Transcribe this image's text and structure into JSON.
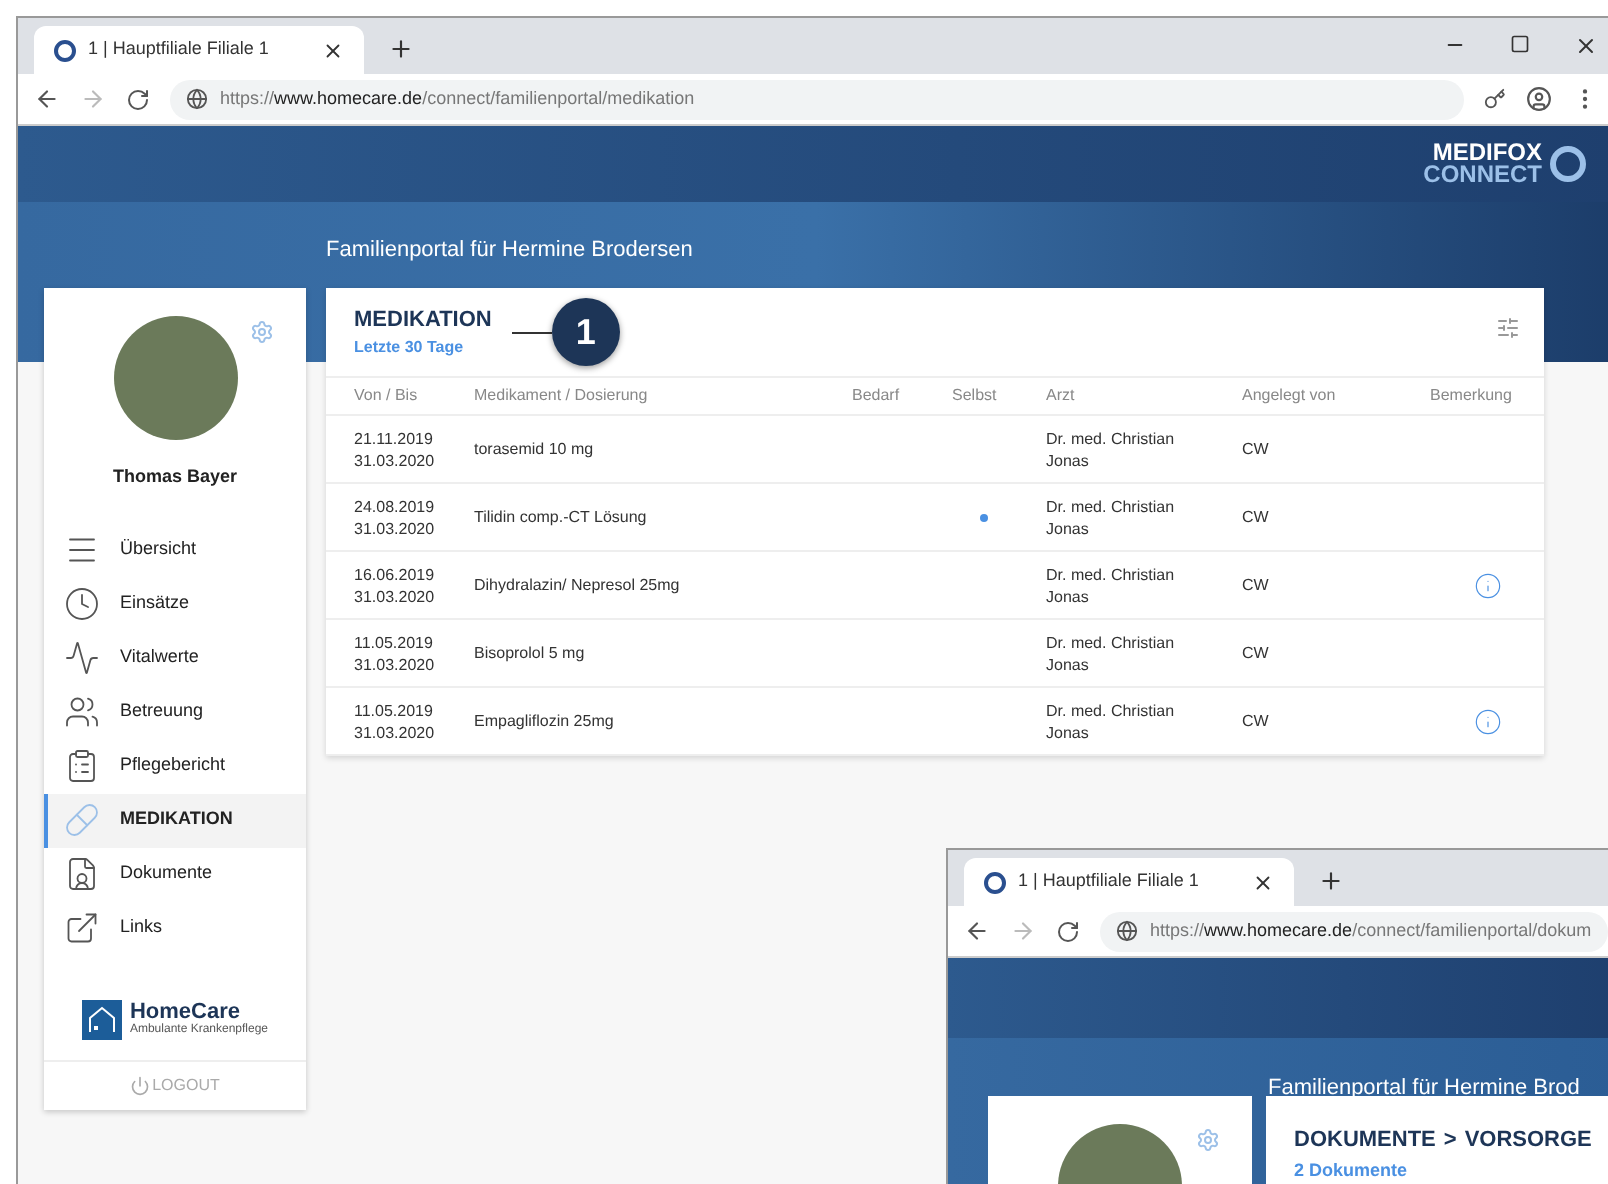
{
  "browser": {
    "tab_title": "1 | Hauptfiliale Filiale 1",
    "url_scheme": "https://",
    "url_host": "www.homecare.de",
    "url_path": "/connect/familienportal/medikation"
  },
  "brand": {
    "line1": "MEDIFOX",
    "line2": "CONNECT"
  },
  "portal_title": "Familienportal für Hermine Brodersen",
  "sidebar": {
    "user_name": "Thomas Bayer",
    "items": [
      {
        "kind": "overview",
        "label": "Übersicht",
        "selected": false
      },
      {
        "kind": "visits",
        "label": "Einsätze",
        "selected": false
      },
      {
        "kind": "vitals",
        "label": "Vitalwerte",
        "selected": false
      },
      {
        "kind": "care",
        "label": "Betreuung",
        "selected": false
      },
      {
        "kind": "report",
        "label": "Pflegebericht",
        "selected": false
      },
      {
        "kind": "medication",
        "label": "MEDIKATION",
        "selected": true
      },
      {
        "kind": "documents",
        "label": "Dokumente",
        "selected": false
      },
      {
        "kind": "links",
        "label": "Links",
        "selected": false
      }
    ],
    "logo_name": "HomeCare",
    "logo_tagline": "Ambulante Krankenpflege",
    "logout": "LOGOUT"
  },
  "card": {
    "title": "MEDIKATION",
    "subtitle": "Letzte 30 Tage",
    "callout": "1"
  },
  "table": {
    "columns": [
      "Von / Bis",
      "Medikament / Dosierung",
      "Bedarf",
      "Selbst",
      "Arzt",
      "Angelegt von",
      "Bemerkung"
    ],
    "rows": [
      {
        "from": "21.11.2019",
        "to": "31.03.2020",
        "medication": "torasemid 10 mg",
        "selbst": false,
        "doctor_1": "Dr. med. Christian",
        "doctor_2": "Jonas",
        "created_by": "CW",
        "remark": false
      },
      {
        "from": "24.08.2019",
        "to": "31.03.2020",
        "medication": "Tilidin comp.-CT Lösung",
        "selbst": true,
        "doctor_1": "Dr. med. Christian",
        "doctor_2": "Jonas",
        "created_by": "CW",
        "remark": false
      },
      {
        "from": "16.06.2019",
        "to": "31.03.2020",
        "medication": "Dihydralazin/ Nepresol 25mg",
        "selbst": false,
        "doctor_1": "Dr. med. Christian",
        "doctor_2": "Jonas",
        "created_by": "CW",
        "remark": true
      },
      {
        "from": "11.05.2019",
        "to": "31.03.2020",
        "medication": "Bisoprolol 5 mg",
        "selbst": false,
        "doctor_1": "Dr. med. Christian",
        "doctor_2": "Jonas",
        "created_by": "CW",
        "remark": false
      },
      {
        "from": "11.05.2019",
        "to": "31.03.2020",
        "medication": "Empagliflozin 25mg",
        "selbst": false,
        "doctor_1": "Dr. med. Christian",
        "doctor_2": "Jonas",
        "created_by": "CW",
        "remark": true
      }
    ]
  },
  "second_window": {
    "tab_title": "1 | Hauptfiliale Filiale 1",
    "url_scheme": "https://",
    "url_host": "www.homecare.de",
    "url_path": "/connect/familienportal/dokum",
    "portal_title": "Familienportal für Hermine Brod",
    "breadcrumb": [
      "DOKUMENTE",
      ">",
      "VORSORGE"
    ],
    "subtitle": "2 Dokumente"
  }
}
